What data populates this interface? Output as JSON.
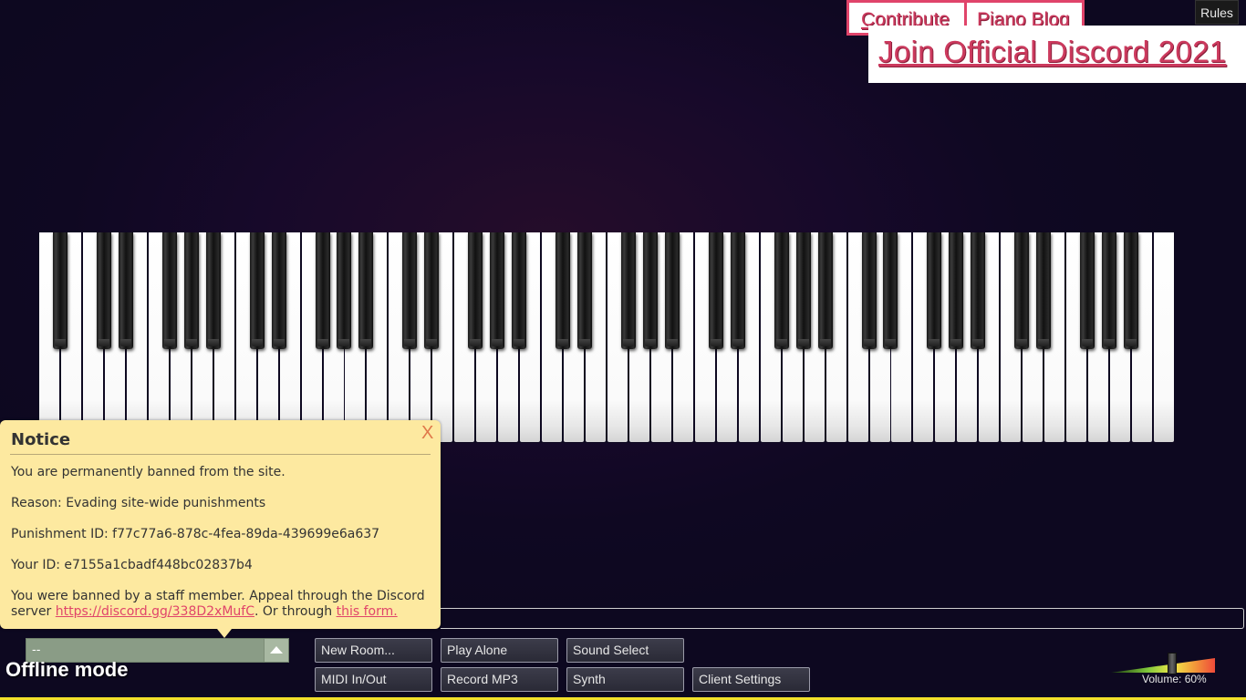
{
  "top_links": {
    "contribute": "Contribute",
    "piano_blog": "Piano Blog",
    "discord": "Join Official Discord 2021",
    "rules": "Rules"
  },
  "piano": {
    "white_key_count": 52,
    "black_key_count": 36
  },
  "notice": {
    "title": "Notice",
    "close": "X",
    "line1": "You are permanently banned from the site.",
    "reason": "Reason: Evading site-wide punishments",
    "punishment_id": "Punishment ID: f77c77a6-878c-4fea-89da-439699e6a637",
    "your_id": "Your ID: e7155a1cbadf448bc02837b4",
    "appeal_prefix": "You were banned by a staff member. Appeal through the Discord server ",
    "appeal_link": "https://discord.gg/338D2xMufC",
    "appeal_middle": ". Or through ",
    "form_link": "this form."
  },
  "room_select": {
    "value": "--"
  },
  "status": {
    "offline": "Offline mode"
  },
  "buttons": {
    "new_room": "New Room...",
    "play_alone": "Play Alone",
    "sound_select": "Sound Select",
    "midi": "MIDI In/Out",
    "record_mp3": "Record MP3",
    "synth": "Synth",
    "client_settings": "Client Settings"
  },
  "volume": {
    "label": "Volume: 60%",
    "level": 0.6
  },
  "colors": {
    "link_accent": "#e0446a",
    "notice_bg": "#fde9a0",
    "background": "#0f0822"
  }
}
